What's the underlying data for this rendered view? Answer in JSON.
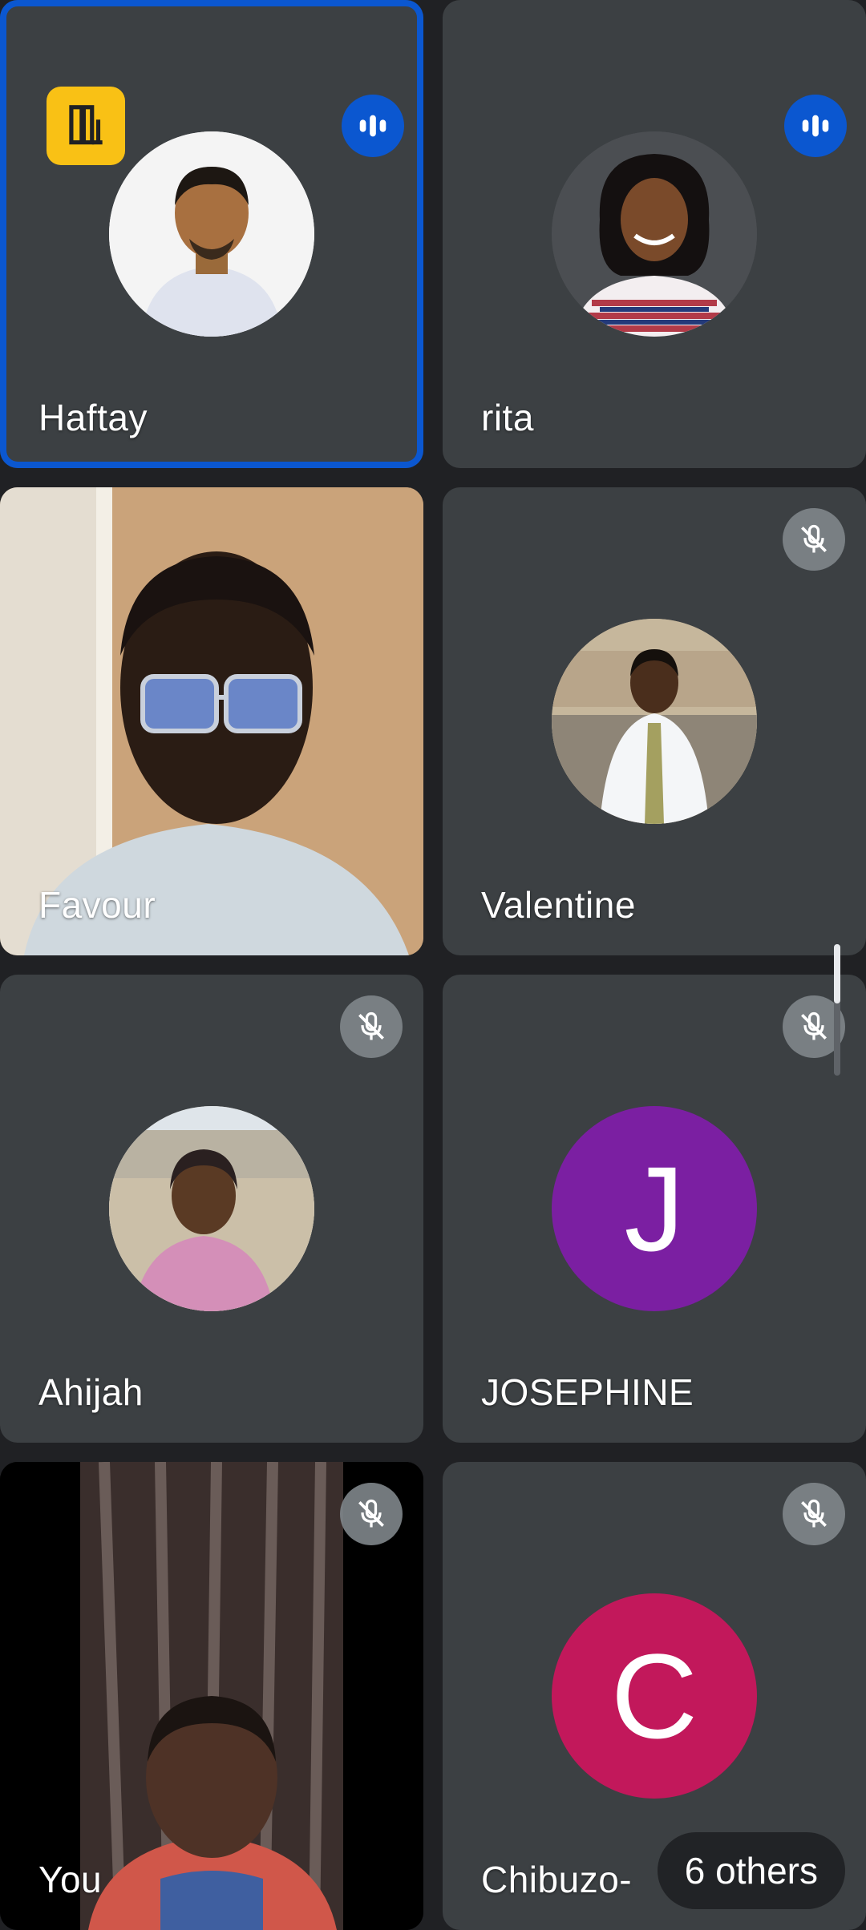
{
  "participants": [
    {
      "name": "Haftay",
      "avatar": "photo",
      "status": "speaking",
      "host": true
    },
    {
      "name": "rita",
      "avatar": "photo",
      "status": "speaking"
    },
    {
      "name": "Favour",
      "avatar": "video",
      "status": "none"
    },
    {
      "name": "Valentine",
      "avatar": "photo",
      "status": "muted"
    },
    {
      "name": "Ahijah",
      "avatar": "photo",
      "status": "muted"
    },
    {
      "name": "JOSEPHINE",
      "avatar": "letter",
      "letter": "J",
      "avatar_color": "#7b1fa2",
      "status": "muted"
    },
    {
      "name": "You",
      "avatar": "video",
      "status": "muted"
    },
    {
      "name": "Chibuzo-",
      "avatar": "letter",
      "letter": "C",
      "avatar_color": "#c2185b",
      "status": "muted"
    }
  ],
  "others": {
    "label": "6 others"
  },
  "colors": {
    "background": "#202124",
    "tile": "#3c4043",
    "active_border": "#0b57d0",
    "speaking_badge": "#0b57d0",
    "host_badge": "#f9c115",
    "mute_badge": "#80868b"
  },
  "icons": {
    "host": "door-exit-icon",
    "speaking": "audio-level-icon",
    "muted": "mic-off-icon"
  }
}
